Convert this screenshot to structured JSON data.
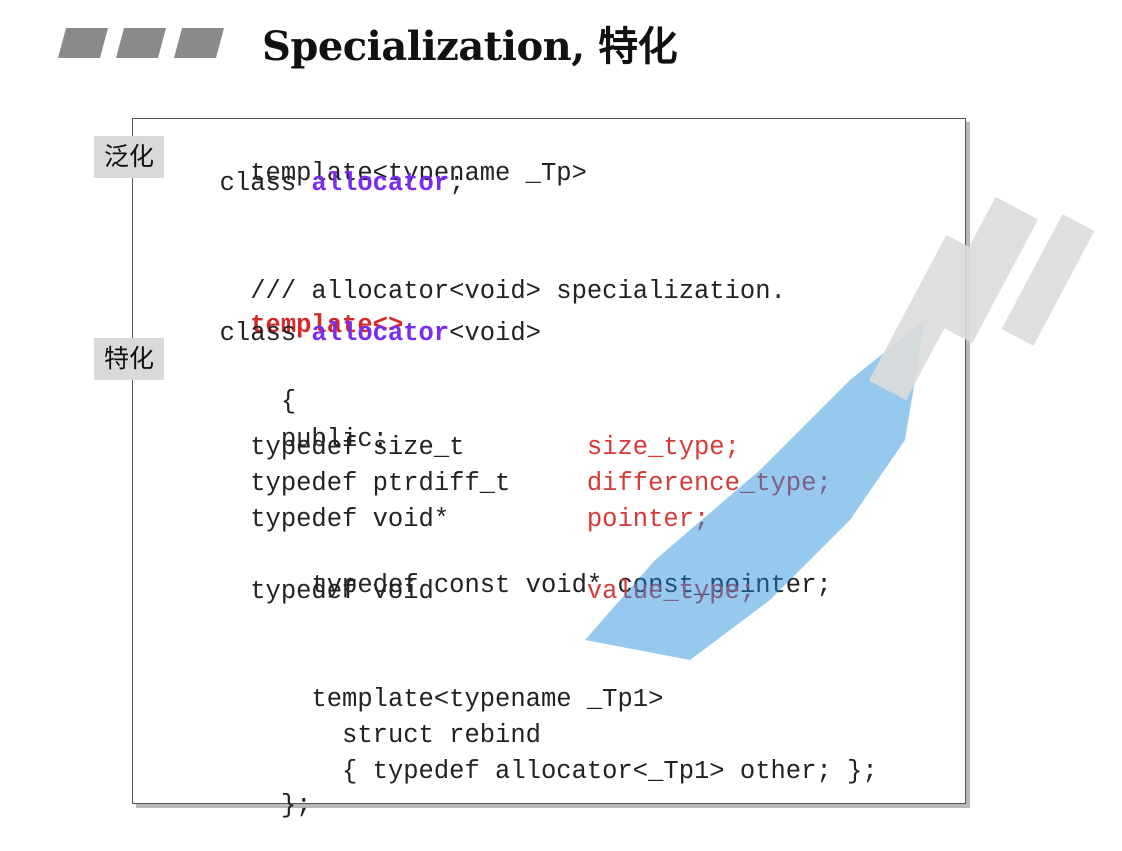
{
  "title": "Specialization, 特化",
  "labels": {
    "generic": "泛化",
    "specialized": "特化"
  },
  "code": {
    "l1": "template<typename _Tp>",
    "l2_a": "  class ",
    "l2_b": "allocator",
    "l2_c": ";",
    "l3": "/// allocator<void> specialization.",
    "l4": "template<>",
    "l5_a": "  class ",
    "l5_b": "allocator",
    "l5_c": "<void>",
    "l6": "  {",
    "l7": "  public:",
    "l8_a": "    typedef size_t        ",
    "l8_b": "size_type;",
    "l9_a": "    typedef ptrdiff_t     ",
    "l9_b": "difference_type;",
    "l10_a": "    typedef void*         ",
    "l10_b": "pointer;",
    "l11": "    typedef const void* const_pointer;",
    "l12_a": "    typedef void          ",
    "l12_b": "value_type;",
    "l13": "    template<typename _Tp1>",
    "l14": "      struct rebind",
    "l15": "      { typedef allocator<_Tp1> other; };",
    "l16": "  };"
  },
  "colors": {
    "keyword_purple": "#7a2df0",
    "keyword_red": "#d42a2a",
    "watermark_blue": "#1e8ad8"
  }
}
